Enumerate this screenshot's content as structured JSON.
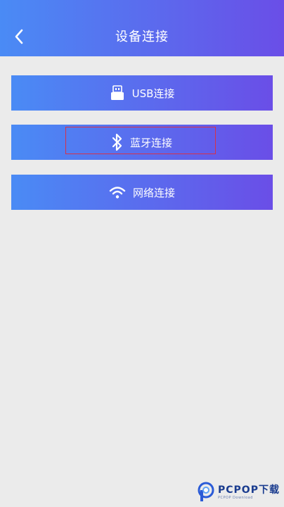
{
  "header": {
    "title": "设备连接",
    "back_icon": "chevron-left-icon"
  },
  "buttons": [
    {
      "label": "USB连接",
      "icon": "usb-icon"
    },
    {
      "label": "蓝牙连接",
      "icon": "bluetooth-icon"
    },
    {
      "label": "网络连接",
      "icon": "wifi-icon"
    }
  ],
  "colors": {
    "gradient_start": "#4a8bf5",
    "gradient_end": "#6a4ee7",
    "background": "#ebebeb",
    "highlight_border": "#d6314a"
  },
  "watermark": {
    "text": "PCPOP下载",
    "subtext": "PCPOP Download"
  }
}
